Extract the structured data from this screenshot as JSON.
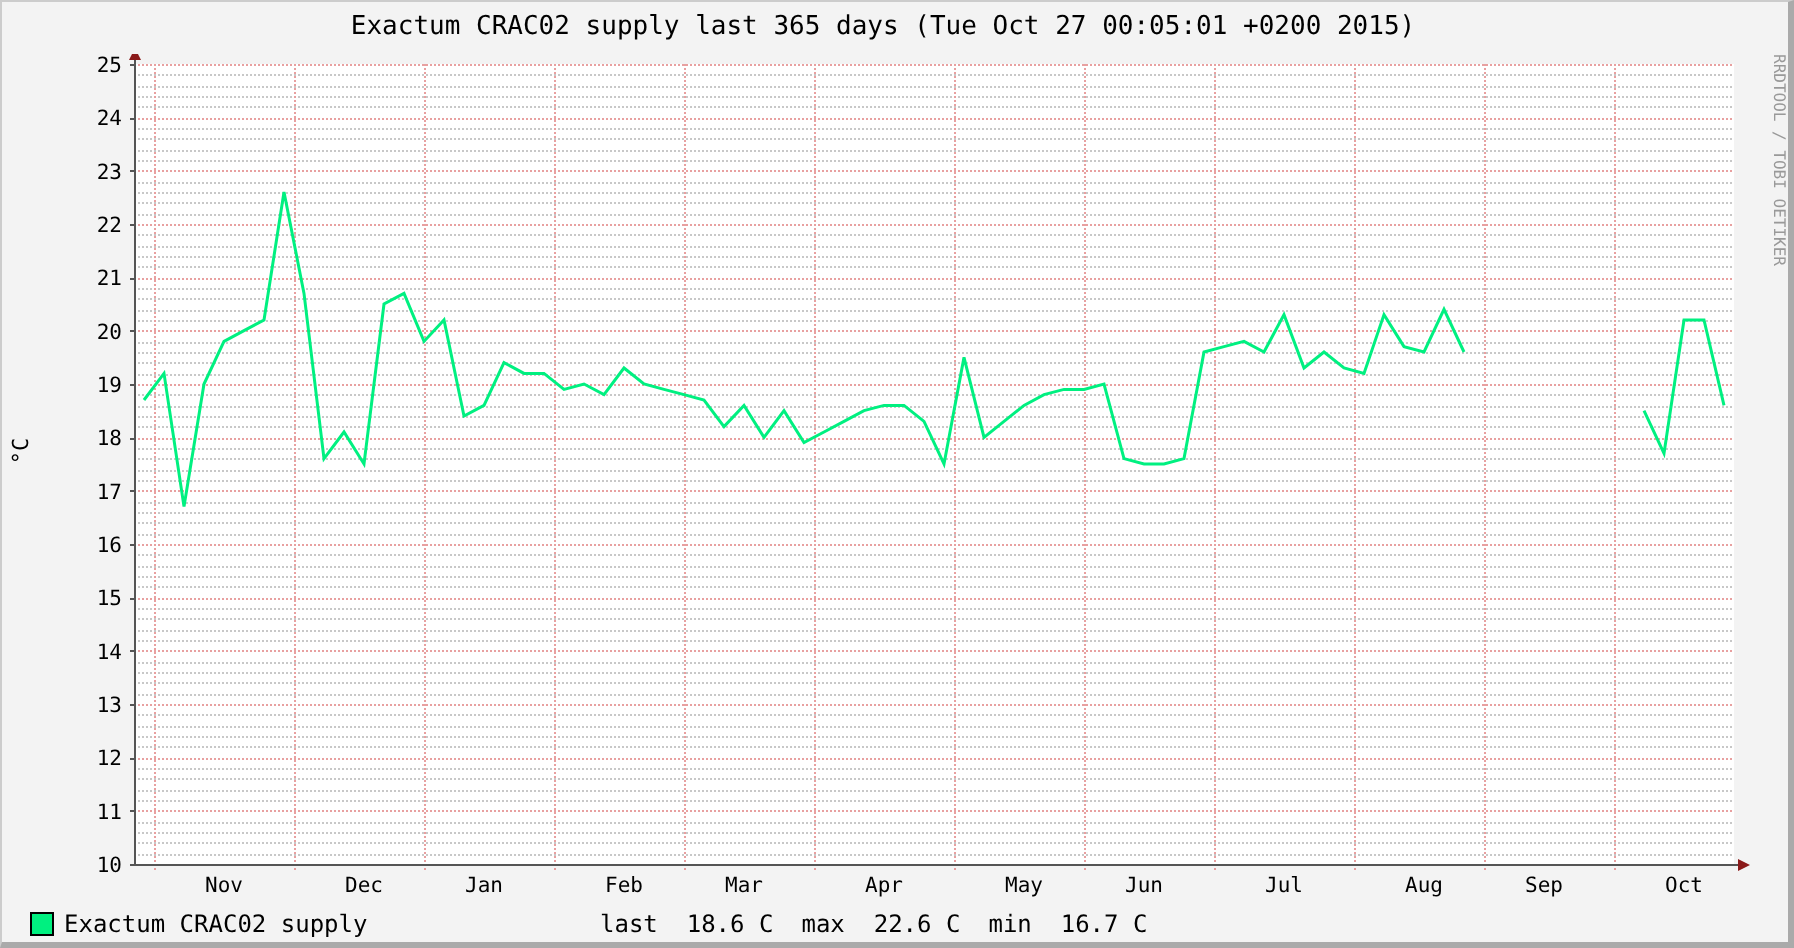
{
  "title": "Exactum CRAC02 supply last 365 days (Tue Oct 27 00:05:01 +0200 2015)",
  "credit": "RRDTOOL / TOBI OETIKER",
  "chart_data": {
    "type": "line",
    "grid": true,
    "ylabel": "°C",
    "ylim": [
      10,
      25
    ],
    "yticks": [
      10,
      11,
      12,
      13,
      14,
      15,
      16,
      17,
      18,
      19,
      20,
      21,
      22,
      23,
      24,
      25
    ],
    "categories": [
      null,
      null,
      null,
      null,
      "Nov",
      null,
      null,
      null,
      null,
      null,
      null,
      "Dec",
      null,
      null,
      null,
      null,
      null,
      "Jan",
      null,
      null,
      null,
      null,
      null,
      null,
      "Feb",
      null,
      null,
      null,
      null,
      null,
      "Mar",
      null,
      null,
      null,
      null,
      null,
      null,
      "Apr",
      null,
      null,
      null,
      null,
      null,
      null,
      "May",
      null,
      null,
      null,
      null,
      null,
      "Jun",
      null,
      null,
      null,
      null,
      null,
      null,
      "Jul",
      null,
      null,
      null,
      null,
      null,
      null,
      "Aug",
      null,
      null,
      null,
      null,
      null,
      "Sep",
      null,
      null,
      null,
      null,
      null,
      null,
      "Oct",
      null,
      null
    ],
    "series": [
      {
        "name": "Exactum CRAC02 supply",
        "color": "#00f080",
        "values": [
          18.7,
          19.2,
          16.7,
          19.0,
          19.8,
          20.0,
          20.2,
          22.6,
          20.7,
          17.6,
          18.1,
          17.5,
          20.5,
          20.7,
          19.8,
          20.2,
          18.4,
          18.6,
          19.4,
          19.2,
          19.2,
          18.9,
          19.0,
          18.8,
          19.3,
          19.0,
          18.9,
          18.8,
          18.7,
          18.2,
          18.6,
          18.0,
          18.5,
          17.9,
          18.1,
          18.3,
          18.5,
          18.6,
          18.6,
          18.3,
          17.5,
          19.5,
          18.0,
          18.3,
          18.6,
          18.8,
          18.9,
          18.9,
          19.0,
          17.6,
          17.5,
          17.5,
          17.6,
          19.6,
          19.7,
          19.8,
          19.6,
          20.3,
          19.3,
          19.6,
          19.3,
          19.2,
          20.3,
          19.7,
          19.6,
          20.4,
          19.6,
          null,
          null,
          null,
          null,
          null,
          null,
          null,
          null,
          18.5,
          17.7,
          20.2,
          20.2,
          18.6
        ]
      }
    ]
  },
  "legend": {
    "stats": [
      {
        "label": "last",
        "value": "18.6 C"
      },
      {
        "label": "max",
        "value": "22.6 C"
      },
      {
        "label": "min",
        "value": "16.7 C"
      }
    ]
  }
}
